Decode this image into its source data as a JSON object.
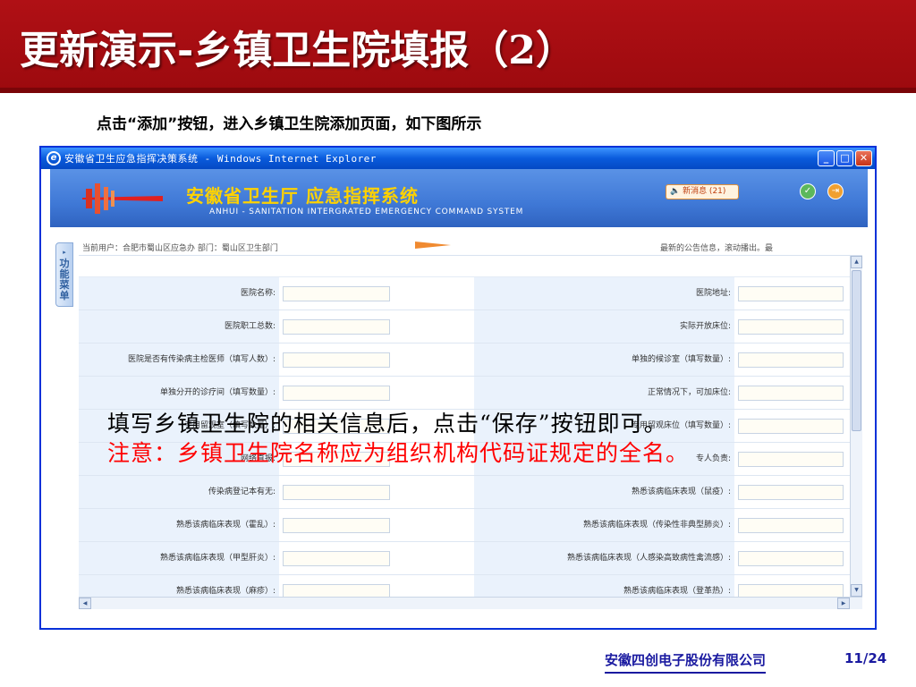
{
  "slide": {
    "title": "更新演示-乡镇卫生院填报（2）",
    "subtitle": "点击“添加”按钮，进入乡镇卫生院添加页面，如下图所示"
  },
  "window": {
    "title": "安徽省卫生应急指挥决策系统 - Windows Internet Explorer",
    "min_glyph": "_",
    "max_glyph": "□",
    "close_glyph": "✕"
  },
  "app": {
    "title_cn": "安徽省卫生厅   应急指挥系统",
    "title_en": "ANHUI - SANITATION INTERGRATED EMERGENCY COMMAND SYSTEM",
    "news_button": "🔈 新消息 (21)",
    "side_menu": "功能菜单",
    "side_menu_arrow": "▸",
    "current_user": "当前用户：合肥市蜀山区应急办   部门：蜀山区卫生部门",
    "news_ticker": "最新的公告信息，滚动播出。最",
    "icon_check": "✓",
    "icon_exit": "⇥"
  },
  "form": {
    "rows": [
      {
        "left": "医院名称:",
        "right": "医院地址:"
      },
      {
        "left": "医院职工总数:",
        "right": "实际开放床位:"
      },
      {
        "left": "医院是否有传染病主检医师（填写人数）:",
        "right": "单独的候诊室（填写数量）:"
      },
      {
        "left": "单独分开的诊疗间（填写数量）:",
        "right": "正常情况下，可加床位:"
      },
      {
        "left": "专用留观室（填写数量）:",
        "right": "专用留观床位（填写数量）:"
      },
      {
        "left": "网络直报:",
        "right": "专人负责:"
      },
      {
        "left": "传染病登记本有无:",
        "right": "熟悉该病临床表现（鼠疫）:"
      },
      {
        "left": "熟悉该病临床表现（霍乱）:",
        "right": "熟悉该病临床表现（传染性非典型肺炎）:"
      },
      {
        "left": "熟悉该病临床表现（甲型肝炎）:",
        "right": "熟悉该病临床表现（人感染高致病性禽流感）:"
      },
      {
        "left": "熟悉该病临床表现（麻疹）:",
        "right": "熟悉该病临床表现（登革热）:"
      }
    ]
  },
  "scroll": {
    "up": "▲",
    "down": "▼",
    "left": "◀",
    "right": "▶"
  },
  "overlay": {
    "instruction": "填写乡镇卫生院的相关信息后，点击“保存”按钮即可。",
    "note": "注意：乡镇卫生院名称应为组织机构代码证规定的全名。"
  },
  "footer": {
    "company": "安徽四创电子股份有限公司",
    "page": "11/24"
  }
}
